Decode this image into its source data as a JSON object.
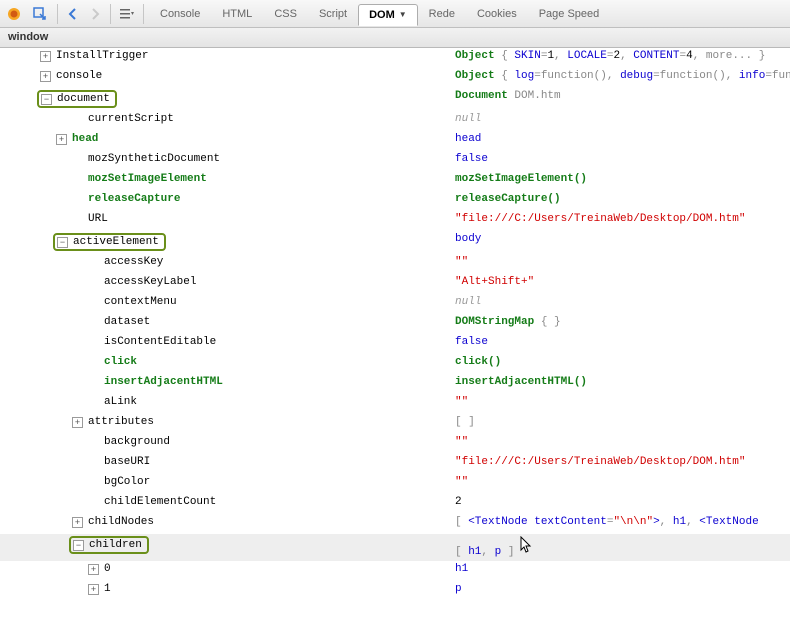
{
  "tabs": [
    "Console",
    "HTML",
    "CSS",
    "Script",
    "DOM",
    "Rede",
    "Cookies",
    "Page Speed"
  ],
  "activeTab": "DOM",
  "breadcrumb": "window",
  "rows": [
    {
      "indent": 40,
      "exp": "plus",
      "key": "InstallTrigger",
      "keyStyle": "plain",
      "valHtml": [
        {
          "t": "Object",
          "c": "val-green"
        },
        {
          "t": " { ",
          "c": "dim"
        },
        {
          "t": "SKIN",
          "c": "val-blue"
        },
        {
          "t": "=",
          "c": "dim"
        },
        {
          "t": "1",
          "c": "val-plain"
        },
        {
          "t": ",  ",
          "c": "dim"
        },
        {
          "t": "LOCALE",
          "c": "val-blue"
        },
        {
          "t": "=",
          "c": "dim"
        },
        {
          "t": "2",
          "c": "val-plain"
        },
        {
          "t": ",  ",
          "c": "dim"
        },
        {
          "t": "CONTENT",
          "c": "val-blue"
        },
        {
          "t": "=",
          "c": "dim"
        },
        {
          "t": "4",
          "c": "val-plain"
        },
        {
          "t": ",  more... }",
          "c": "dim"
        }
      ]
    },
    {
      "indent": 40,
      "exp": "plus",
      "key": "console",
      "keyStyle": "plain",
      "valHtml": [
        {
          "t": "Object",
          "c": "val-green"
        },
        {
          "t": " { ",
          "c": "dim"
        },
        {
          "t": "log",
          "c": "val-blue"
        },
        {
          "t": "=function(),  ",
          "c": "dim"
        },
        {
          "t": "debug",
          "c": "val-blue"
        },
        {
          "t": "=function(),  ",
          "c": "dim"
        },
        {
          "t": "info",
          "c": "val-blue"
        },
        {
          "t": "=functio",
          "c": "dim"
        }
      ]
    },
    {
      "indent": 40,
      "exp": "minus",
      "highlight": true,
      "key": "document",
      "keyStyle": "plain",
      "valHtml": [
        {
          "t": "Document ",
          "c": "val-green"
        },
        {
          "t": "DOM.htm",
          "c": "dim"
        }
      ]
    },
    {
      "indent": 72,
      "exp": null,
      "key": "currentScript",
      "keyStyle": "plain",
      "valHtml": [
        {
          "t": "null",
          "c": "val-gray"
        }
      ]
    },
    {
      "indent": 56,
      "exp": "plus",
      "key": "head",
      "keyStyle": "user",
      "valHtml": [
        {
          "t": "head",
          "c": "val-blue"
        }
      ]
    },
    {
      "indent": 72,
      "exp": null,
      "key": "mozSyntheticDocument",
      "keyStyle": "plain",
      "valHtml": [
        {
          "t": "false",
          "c": "val-blue"
        }
      ]
    },
    {
      "indent": 72,
      "exp": null,
      "key": "mozSetImageElement",
      "keyStyle": "user",
      "valHtml": [
        {
          "t": "mozSetImageElement()",
          "c": "val-green"
        }
      ]
    },
    {
      "indent": 72,
      "exp": null,
      "key": "releaseCapture",
      "keyStyle": "user",
      "valHtml": [
        {
          "t": "releaseCapture()",
          "c": "val-green"
        }
      ]
    },
    {
      "indent": 72,
      "exp": null,
      "key": "URL",
      "keyStyle": "plain",
      "valHtml": [
        {
          "t": "\"file:///C:/Users/TreinaWeb/Desktop/DOM.htm\"",
          "c": "val-red"
        }
      ]
    },
    {
      "indent": 56,
      "exp": "minus",
      "highlight": true,
      "key": "activeElement",
      "keyStyle": "plain",
      "valHtml": [
        {
          "t": "body",
          "c": "val-blue"
        }
      ]
    },
    {
      "indent": 88,
      "exp": null,
      "key": "accessKey",
      "keyStyle": "plain",
      "valHtml": [
        {
          "t": "\"\"",
          "c": "val-red"
        }
      ]
    },
    {
      "indent": 88,
      "exp": null,
      "key": "accessKeyLabel",
      "keyStyle": "plain",
      "valHtml": [
        {
          "t": "\"Alt+Shift+\"",
          "c": "val-red"
        }
      ]
    },
    {
      "indent": 88,
      "exp": null,
      "key": "contextMenu",
      "keyStyle": "plain",
      "valHtml": [
        {
          "t": "null",
          "c": "val-gray"
        }
      ]
    },
    {
      "indent": 88,
      "exp": null,
      "key": "dataset",
      "keyStyle": "plain",
      "valHtml": [
        {
          "t": "DOMStringMap",
          "c": "val-green"
        },
        {
          "t": " {  }",
          "c": "dim"
        }
      ]
    },
    {
      "indent": 88,
      "exp": null,
      "key": "isContentEditable",
      "keyStyle": "plain",
      "valHtml": [
        {
          "t": "false",
          "c": "val-blue"
        }
      ]
    },
    {
      "indent": 88,
      "exp": null,
      "key": "click",
      "keyStyle": "user",
      "valHtml": [
        {
          "t": "click()",
          "c": "val-green"
        }
      ]
    },
    {
      "indent": 88,
      "exp": null,
      "key": "insertAdjacentHTML",
      "keyStyle": "user",
      "valHtml": [
        {
          "t": "insertAdjacentHTML()",
          "c": "val-green"
        }
      ]
    },
    {
      "indent": 88,
      "exp": null,
      "key": "aLink",
      "keyStyle": "plain",
      "valHtml": [
        {
          "t": "\"\"",
          "c": "val-red"
        }
      ]
    },
    {
      "indent": 72,
      "exp": "plus",
      "key": "attributes",
      "keyStyle": "plain",
      "valHtml": [
        {
          "t": "[",
          "c": "dim"
        },
        {
          "t": "  ",
          "c": ""
        },
        {
          "t": "]",
          "c": "dim"
        }
      ]
    },
    {
      "indent": 88,
      "exp": null,
      "key": "background",
      "keyStyle": "plain",
      "valHtml": [
        {
          "t": "\"\"",
          "c": "val-red"
        }
      ]
    },
    {
      "indent": 88,
      "exp": null,
      "key": "baseURI",
      "keyStyle": "plain",
      "valHtml": [
        {
          "t": "\"file:///C:/Users/TreinaWeb/Desktop/DOM.htm\"",
          "c": "val-red"
        }
      ]
    },
    {
      "indent": 88,
      "exp": null,
      "key": "bgColor",
      "keyStyle": "plain",
      "valHtml": [
        {
          "t": "\"\"",
          "c": "val-red"
        }
      ]
    },
    {
      "indent": 88,
      "exp": null,
      "key": "childElementCount",
      "keyStyle": "plain",
      "valHtml": [
        {
          "t": "2",
          "c": "val-plain"
        }
      ]
    },
    {
      "indent": 72,
      "exp": "plus",
      "key": "childNodes",
      "keyStyle": "plain",
      "valHtml": [
        {
          "t": "[ ",
          "c": "dim"
        },
        {
          "t": "<TextNode",
          "c": "val-blue"
        },
        {
          "t": " textContent",
          "c": "val-blue"
        },
        {
          "t": "=",
          "c": "dim"
        },
        {
          "t": "\"\\n\\n\"",
          "c": "val-red"
        },
        {
          "t": ">",
          "c": "val-blue"
        },
        {
          "t": ", ",
          "c": "dim"
        },
        {
          "t": "h1",
          "c": "val-blue"
        },
        {
          "t": ", ",
          "c": "dim"
        },
        {
          "t": "<TextNode",
          "c": "val-blue"
        }
      ]
    },
    {
      "indent": 72,
      "exp": "minus",
      "highlight": true,
      "hover": true,
      "key": "children",
      "keyStyle": "plain",
      "valHtml": [
        {
          "t": "[ ",
          "c": "dim"
        },
        {
          "t": "h1",
          "c": "val-blue"
        },
        {
          "t": ", ",
          "c": "dim"
        },
        {
          "t": "p",
          "c": "val-blue"
        },
        {
          "t": " ]",
          "c": "dim"
        }
      ],
      "cursor": true
    },
    {
      "indent": 88,
      "exp": "plus",
      "key": "0",
      "keyStyle": "plain",
      "valHtml": [
        {
          "t": "h1",
          "c": "val-blue"
        }
      ]
    },
    {
      "indent": 88,
      "exp": "plus",
      "key": "1",
      "keyStyle": "plain",
      "valHtml": [
        {
          "t": "p",
          "c": "val-blue"
        }
      ]
    }
  ]
}
